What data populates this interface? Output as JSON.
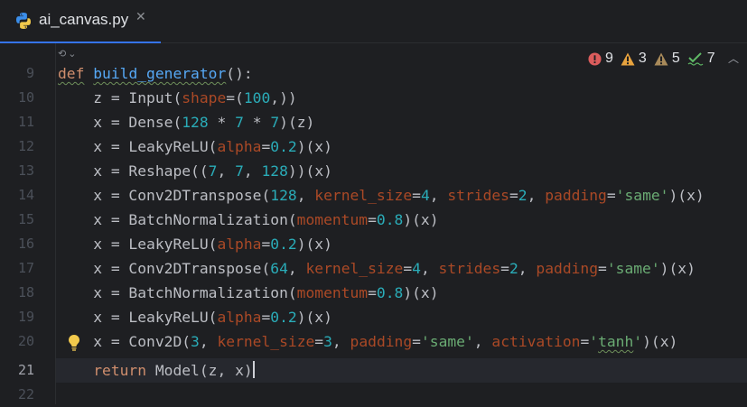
{
  "tab": {
    "filename": "ai_canvas.py",
    "icon": "python-file-icon",
    "close_glyph": "✕",
    "accent_color": "#3574f0"
  },
  "inlay": {
    "glyph": "⟲",
    "chevron": "⌄"
  },
  "inspections": {
    "errors": "9",
    "warnings": "3",
    "weak_warnings": "5",
    "typos": "7",
    "error_color": "#db5c5c",
    "warning_color": "#e8a33e",
    "ok_color": "#5fb865"
  },
  "gutter": {
    "line_numbers": [
      "9",
      "10",
      "11",
      "12",
      "13",
      "14",
      "15",
      "16",
      "17",
      "18",
      "19",
      "20",
      "21",
      "22"
    ],
    "current_line": "21"
  },
  "code": {
    "l9": {
      "def": "def",
      "name": "build_generator",
      "rest": "():"
    },
    "l10": {
      "a": "z = Input(",
      "p1": "shape",
      "b": "=(",
      "n1": "100",
      "c": ",))"
    },
    "l11": {
      "a": "x = Dense(",
      "n1": "128",
      "b": " * ",
      "n2": "7",
      "c": " * ",
      "n3": "7",
      "d": ")(z)"
    },
    "l12": {
      "a": "x = LeakyReLU(",
      "p1": "alpha",
      "b": "=",
      "n1": "0.2",
      "c": ")(x)"
    },
    "l13": {
      "a": "x = Reshape((",
      "n1": "7",
      "b": ", ",
      "n2": "7",
      "c": ", ",
      "n3": "128",
      "d": "))(x)"
    },
    "l14": {
      "a": "x = Conv2DTranspose(",
      "n1": "128",
      "b": ", ",
      "p1": "kernel_size",
      "c": "=",
      "n2": "4",
      "d": ", ",
      "p2": "strides",
      "e": "=",
      "n3": "2",
      "f": ", ",
      "p3": "padding",
      "g": "=",
      "s1": "'same'",
      "h": ")(x)"
    },
    "l15": {
      "a": "x = BatchNormalization(",
      "p1": "momentum",
      "b": "=",
      "n1": "0.8",
      "c": ")(x)"
    },
    "l16": {
      "a": "x = LeakyReLU(",
      "p1": "alpha",
      "b": "=",
      "n1": "0.2",
      "c": ")(x)"
    },
    "l17": {
      "a": "x = Conv2DTranspose(",
      "n1": "64",
      "b": ", ",
      "p1": "kernel_size",
      "c": "=",
      "n2": "4",
      "d": ", ",
      "p2": "strides",
      "e": "=",
      "n3": "2",
      "f": ", ",
      "p3": "padding",
      "g": "=",
      "s1": "'same'",
      "h": ")(x)"
    },
    "l18": {
      "a": "x = BatchNormalization(",
      "p1": "momentum",
      "b": "=",
      "n1": "0.8",
      "c": ")(x)"
    },
    "l19": {
      "a": "x = LeakyReLU(",
      "p1": "alpha",
      "b": "=",
      "n1": "0.2",
      "c": ")(x)"
    },
    "l20": {
      "a": "x = Conv2D(",
      "n1": "3",
      "b": ", ",
      "p1": "kernel_size",
      "c": "=",
      "n2": "3",
      "d": ", ",
      "p2": "padding",
      "e": "=",
      "s1": "'same'",
      "f": ", ",
      "p3": "activation",
      "g": "=",
      "s2a": "'",
      "s2b": "tanh",
      "s2c": "'",
      "h": ")(x)"
    },
    "l21": {
      "ret": "return",
      "a": " Model(z, x)"
    },
    "l22": {}
  },
  "intention_icon": "lightbulb-icon"
}
